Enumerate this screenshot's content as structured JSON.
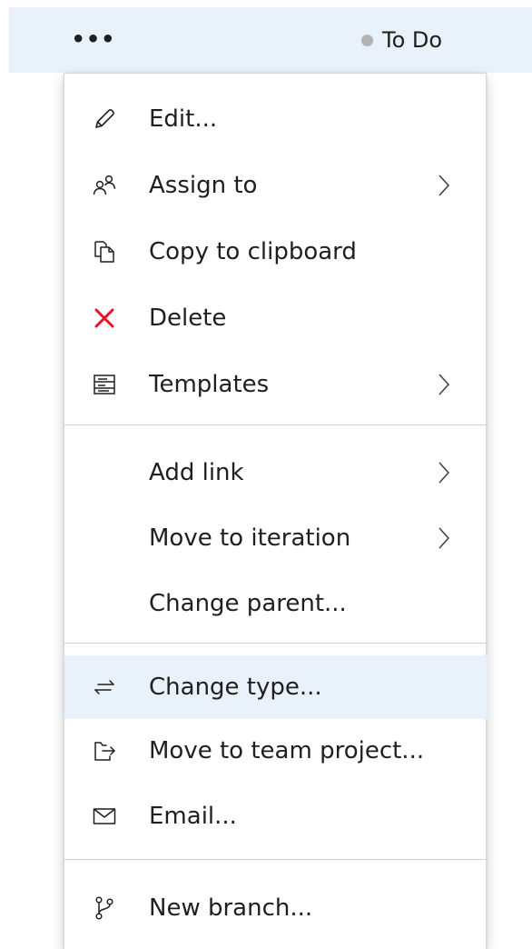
{
  "row": {
    "more_label": "•••",
    "state_label": "To Do",
    "state_color": "#b2b2b2"
  },
  "menu": {
    "items": [
      {
        "label": "Edit...",
        "icon": "pencil-icon",
        "submenu": false
      },
      {
        "label": "Assign to",
        "icon": "people-icon",
        "submenu": true
      },
      {
        "label": "Copy to clipboard",
        "icon": "copy-icon",
        "submenu": false
      },
      {
        "label": "Delete",
        "icon": "delete-x-icon",
        "submenu": false,
        "icon_color": "#e81123"
      },
      {
        "label": "Templates",
        "icon": "templates-icon",
        "submenu": true
      },
      {
        "label": "Add link",
        "icon": "",
        "submenu": true
      },
      {
        "label": "Move to iteration",
        "icon": "",
        "submenu": true
      },
      {
        "label": "Change parent...",
        "icon": "",
        "submenu": false
      },
      {
        "label": "Change type...",
        "icon": "swap-arrows-icon",
        "submenu": false,
        "hovered": true
      },
      {
        "label": "Move to team project...",
        "icon": "move-project-icon",
        "submenu": false
      },
      {
        "label": "Email...",
        "icon": "envelope-icon",
        "submenu": false
      },
      {
        "label": "New branch...",
        "icon": "branch-icon",
        "submenu": false
      }
    ]
  },
  "colors": {
    "hover_background": "#e9f1fa",
    "delete_red": "#e81123",
    "divider": "#d0d0d0"
  }
}
